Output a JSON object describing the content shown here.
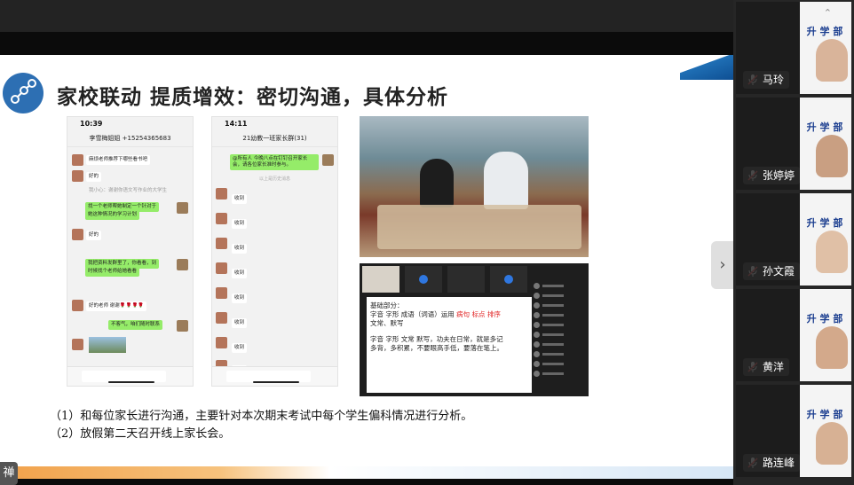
{
  "slide": {
    "title": "家校联动 提质增效：密切沟通，具体分析",
    "notes": [
      "（1）和每位家长进行沟通，主要针对本次期末考试中每个学生偏科情况进行分析。",
      "（2）放假第二天召开线上家长会。"
    ],
    "phone1": {
      "time": "10:39",
      "title": "李雪梅姐姐 +15254365683",
      "messages": [
        {
          "dir": "in",
          "text": "麻烦老师推荐下哪些看书吧"
        },
        {
          "dir": "in",
          "text": "好的"
        },
        {
          "dir": "in",
          "text": "我小心：谢谢你语文写作业的大学生"
        },
        {
          "dir": "out",
          "text": "找一个老师帮她制定一个针对于"
        },
        {
          "dir": "out",
          "text": "她这种情况的学习计划"
        },
        {
          "dir": "in",
          "text": "好的"
        },
        {
          "dir": "out",
          "text": "我把资料发群里了，你看看，到"
        },
        {
          "dir": "out",
          "text": "时候找个老师给她看看"
        },
        {
          "dir": "in",
          "text": "好的老师 谢谢🌹🌹🌹🌹"
        },
        {
          "dir": "out",
          "text": "不客气，咱们随时联系"
        }
      ]
    },
    "phone2": {
      "time": "14:11",
      "title": "21幼教一班家长群(31)",
      "top_message": "@所有人 今晚八点在钉钉召开家长会，请各位家长准时参与。",
      "system_note": "以上是历史消息",
      "replies": [
        "收到",
        "收到",
        "收到",
        "收到",
        "收到",
        "收到",
        "收到",
        "收到"
      ]
    },
    "whiteboard": {
      "line1": "基础部分：",
      "line2_plain": "字音  字形  成语（词语）运用",
      "line2_red": [
        "病句",
        "标点",
        "排序"
      ],
      "line3": "文常、默写",
      "line4": "字音  字形  文常    默写，功夫在日常，就是多记",
      "line5": "多背，多积累，不要眼高手低，要落在笔上。"
    }
  },
  "side_panel": {
    "banner_text": "升 学 部\n程学语\n报名",
    "participants": [
      {
        "name": "马玲",
        "muted": true
      },
      {
        "name": "张婷婷",
        "muted": true
      },
      {
        "name": "孙文霞",
        "muted": true
      },
      {
        "name": "黄洋",
        "muted": true
      },
      {
        "name": "路连峰",
        "muted": true
      }
    ]
  },
  "controls": {
    "next_arrow": "›",
    "corner_chip": "禅"
  },
  "colors": {
    "accent_blue": "#1f6fb5",
    "wechat_green": "#95ec69",
    "red_highlight": "#e02020"
  }
}
